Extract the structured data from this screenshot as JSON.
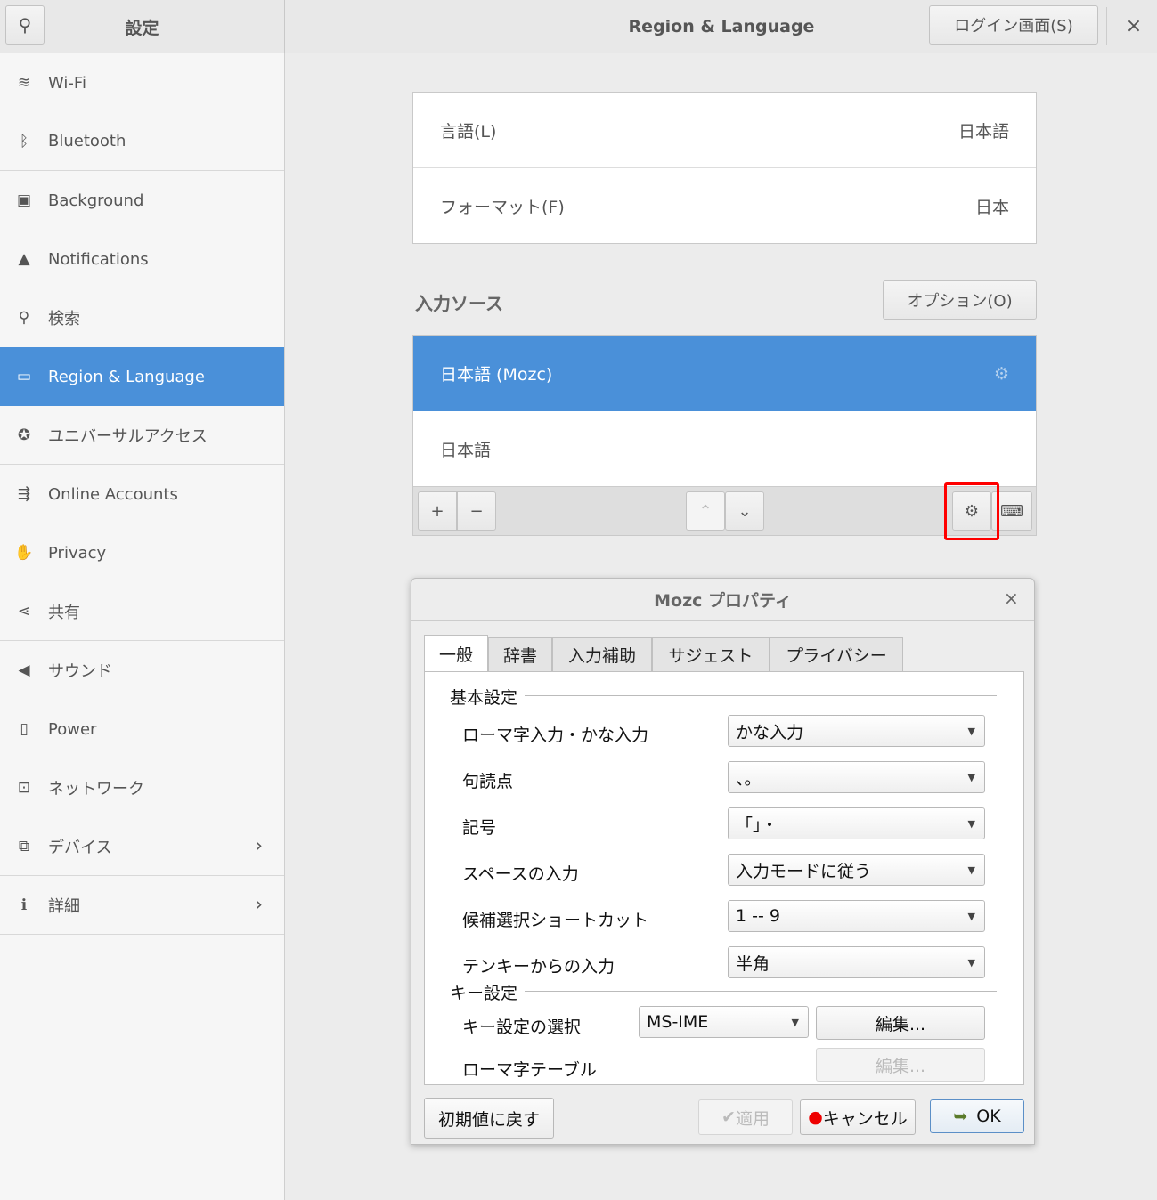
{
  "header": {
    "sidebar_title": "設定",
    "title": "Region & Language",
    "login_button": "ログイン画面(S)",
    "close": "×"
  },
  "sidebar": {
    "items": [
      {
        "label": "Wi-Fi",
        "icon": "wifi-icon",
        "glyph": "≋"
      },
      {
        "label": "Bluetooth",
        "icon": "bluetooth-icon",
        "glyph": "ᛒ"
      },
      {
        "label": "Background",
        "icon": "background-icon",
        "glyph": "▣"
      },
      {
        "label": "Notifications",
        "icon": "bell-icon",
        "glyph": "▲"
      },
      {
        "label": "検索",
        "icon": "search-icon",
        "glyph": "⚲"
      },
      {
        "label": "Region & Language",
        "icon": "region-icon",
        "glyph": "▭"
      },
      {
        "label": "ユニバーサルアクセス",
        "icon": "accessibility-icon",
        "glyph": "✪"
      },
      {
        "label": "Online Accounts",
        "icon": "online-accounts-icon",
        "glyph": "⇶"
      },
      {
        "label": "Privacy",
        "icon": "hand-icon",
        "glyph": "✋"
      },
      {
        "label": "共有",
        "icon": "share-icon",
        "glyph": "⋖"
      },
      {
        "label": "サウンド",
        "icon": "speaker-icon",
        "glyph": "◀"
      },
      {
        "label": "Power",
        "icon": "power-icon",
        "glyph": "▯"
      },
      {
        "label": "ネットワーク",
        "icon": "network-icon",
        "glyph": "⊡"
      },
      {
        "label": "デバイス",
        "icon": "devices-icon",
        "glyph": "⧉",
        "chevron": "›"
      },
      {
        "label": "詳細",
        "icon": "info-icon",
        "glyph": "ℹ",
        "chevron": "›"
      }
    ],
    "selected": "Region & Language"
  },
  "main": {
    "language_label": "言語(L)",
    "language_value": "日本語",
    "format_label": "フォーマット(F)",
    "format_value": "日本",
    "input_sources_title": "入力ソース",
    "options_button": "オプション(O)",
    "sources": [
      "日本語 (Mozc)",
      "日本語"
    ],
    "toolbar": {
      "add": "+",
      "remove": "−",
      "up": "⌃",
      "down": "⌄"
    },
    "highlight_color": "#ff0000",
    "accent": "#4a90d9"
  },
  "dialog": {
    "title": "Mozc プロパティ",
    "close": "×",
    "tabs": [
      "一般",
      "辞書",
      "入力補助",
      "サジェスト",
      "プライバシー"
    ],
    "basic_section": "基本設定",
    "settings": [
      {
        "label": "ローマ字入力・かな入力",
        "value": "かな入力"
      },
      {
        "label": "句読点",
        "value": "、。"
      },
      {
        "label": "記号",
        "value": "「」・"
      },
      {
        "label": "スペースの入力",
        "value": "入力モードに従う"
      },
      {
        "label": "候補選択ショートカット",
        "value": "1 -- 9"
      },
      {
        "label": "テンキーからの入力",
        "value": "半角"
      }
    ],
    "key_section": "キー設定",
    "keymap_label": "キー設定の選択",
    "keymap_value": "MS-IME",
    "edit": "編集...",
    "romaji_label": "ローマ字テーブル",
    "romaji_edit": "編集...",
    "reset": "初期値に戻す",
    "apply": "適用",
    "cancel": "キャンセル",
    "ok": "OK"
  }
}
